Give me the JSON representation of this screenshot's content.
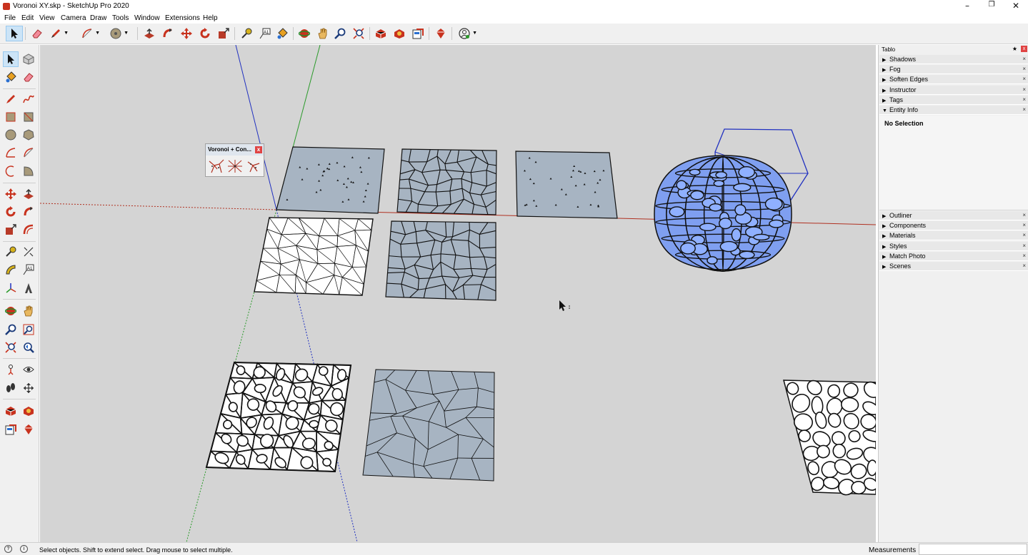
{
  "window": {
    "title": "Voronoi XY.skp - SketchUp Pro 2020",
    "minimize": "–",
    "restore": "❐",
    "close": "✕"
  },
  "menu": [
    "File",
    "Edit",
    "View",
    "Camera",
    "Draw",
    "Tools",
    "Window",
    "Extensions",
    "Help"
  ],
  "top_toolbar": {
    "tools": [
      "select-icon",
      "eraser-icon",
      "pencil-icon",
      "arc-icon",
      "circle-icon",
      "push-pull-icon",
      "follow-me-icon",
      "move-icon",
      "rotate-icon",
      "scale-icon",
      "tape-measure-icon",
      "text-icon",
      "paint-bucket-icon",
      "orbit-icon",
      "pan-icon",
      "zoom-icon",
      "zoom-extents-icon",
      "3d-warehouse-icon",
      "extension-warehouse-icon",
      "layout-icon",
      "extension-manager-icon",
      "account-icon"
    ]
  },
  "left_toolbar": {
    "tools": [
      "select-icon",
      "component-icon",
      "paint-bucket-icon",
      "eraser-icon",
      "pencil-icon",
      "freehand-icon",
      "rectangle-icon",
      "rotated-rectangle-icon",
      "circle-icon",
      "polygon-icon",
      "arc-icon",
      "two-point-arc-icon",
      "three-point-arc-icon",
      "pie-icon",
      "move-icon",
      "push-pull-icon",
      "rotate-icon",
      "follow-me-icon",
      "scale-icon",
      "offset-icon",
      "tape-measure-icon",
      "dimension-icon",
      "protractor-icon",
      "text-icon",
      "axes-icon",
      "3d-text-icon",
      "orbit-icon",
      "pan-icon",
      "zoom-icon",
      "zoom-window-icon",
      "zoom-extents-icon",
      "previous-view-icon",
      "position-camera-icon",
      "look-around-icon",
      "walk-icon",
      "section-plane-icon",
      "3d-warehouse-icon",
      "extension-warehouse-icon",
      "layout-icon",
      "ruby-icon"
    ]
  },
  "voronoi_toolbar": {
    "title": "Voronoi + Con...",
    "close": "x"
  },
  "tray": {
    "title": "Tablo",
    "pin": "★",
    "close": "x",
    "panels_top": [
      {
        "label": "Shadows",
        "expanded": false
      },
      {
        "label": "Fog",
        "expanded": false
      },
      {
        "label": "Soften Edges",
        "expanded": false
      },
      {
        "label": "Instructor",
        "expanded": false
      },
      {
        "label": "Tags",
        "expanded": false
      },
      {
        "label": "Entity Info",
        "expanded": true
      }
    ],
    "entity_info": {
      "selection": "No Selection"
    },
    "panels_bottom": [
      {
        "label": "Outliner"
      },
      {
        "label": "Components"
      },
      {
        "label": "Materials"
      },
      {
        "label": "Styles"
      },
      {
        "label": "Match Photo"
      },
      {
        "label": "Scenes"
      }
    ],
    "collapsed_arrow": "▶",
    "expanded_arrow": "▼",
    "panel_close": "×"
  },
  "status": {
    "hint": "Select objects. Shift to extend select. Drag mouse to select multiple.",
    "measurements_label": "Measurements",
    "measurements_value": ""
  },
  "colors": {
    "viewport_bg": "#d4d4d4",
    "face_blue_grey": "#a7b4c2",
    "sphere_blue": "#7f9ff0",
    "axis_red": "#b03020",
    "axis_green": "#2a9a2a",
    "axis_blue": "#2030c0"
  }
}
